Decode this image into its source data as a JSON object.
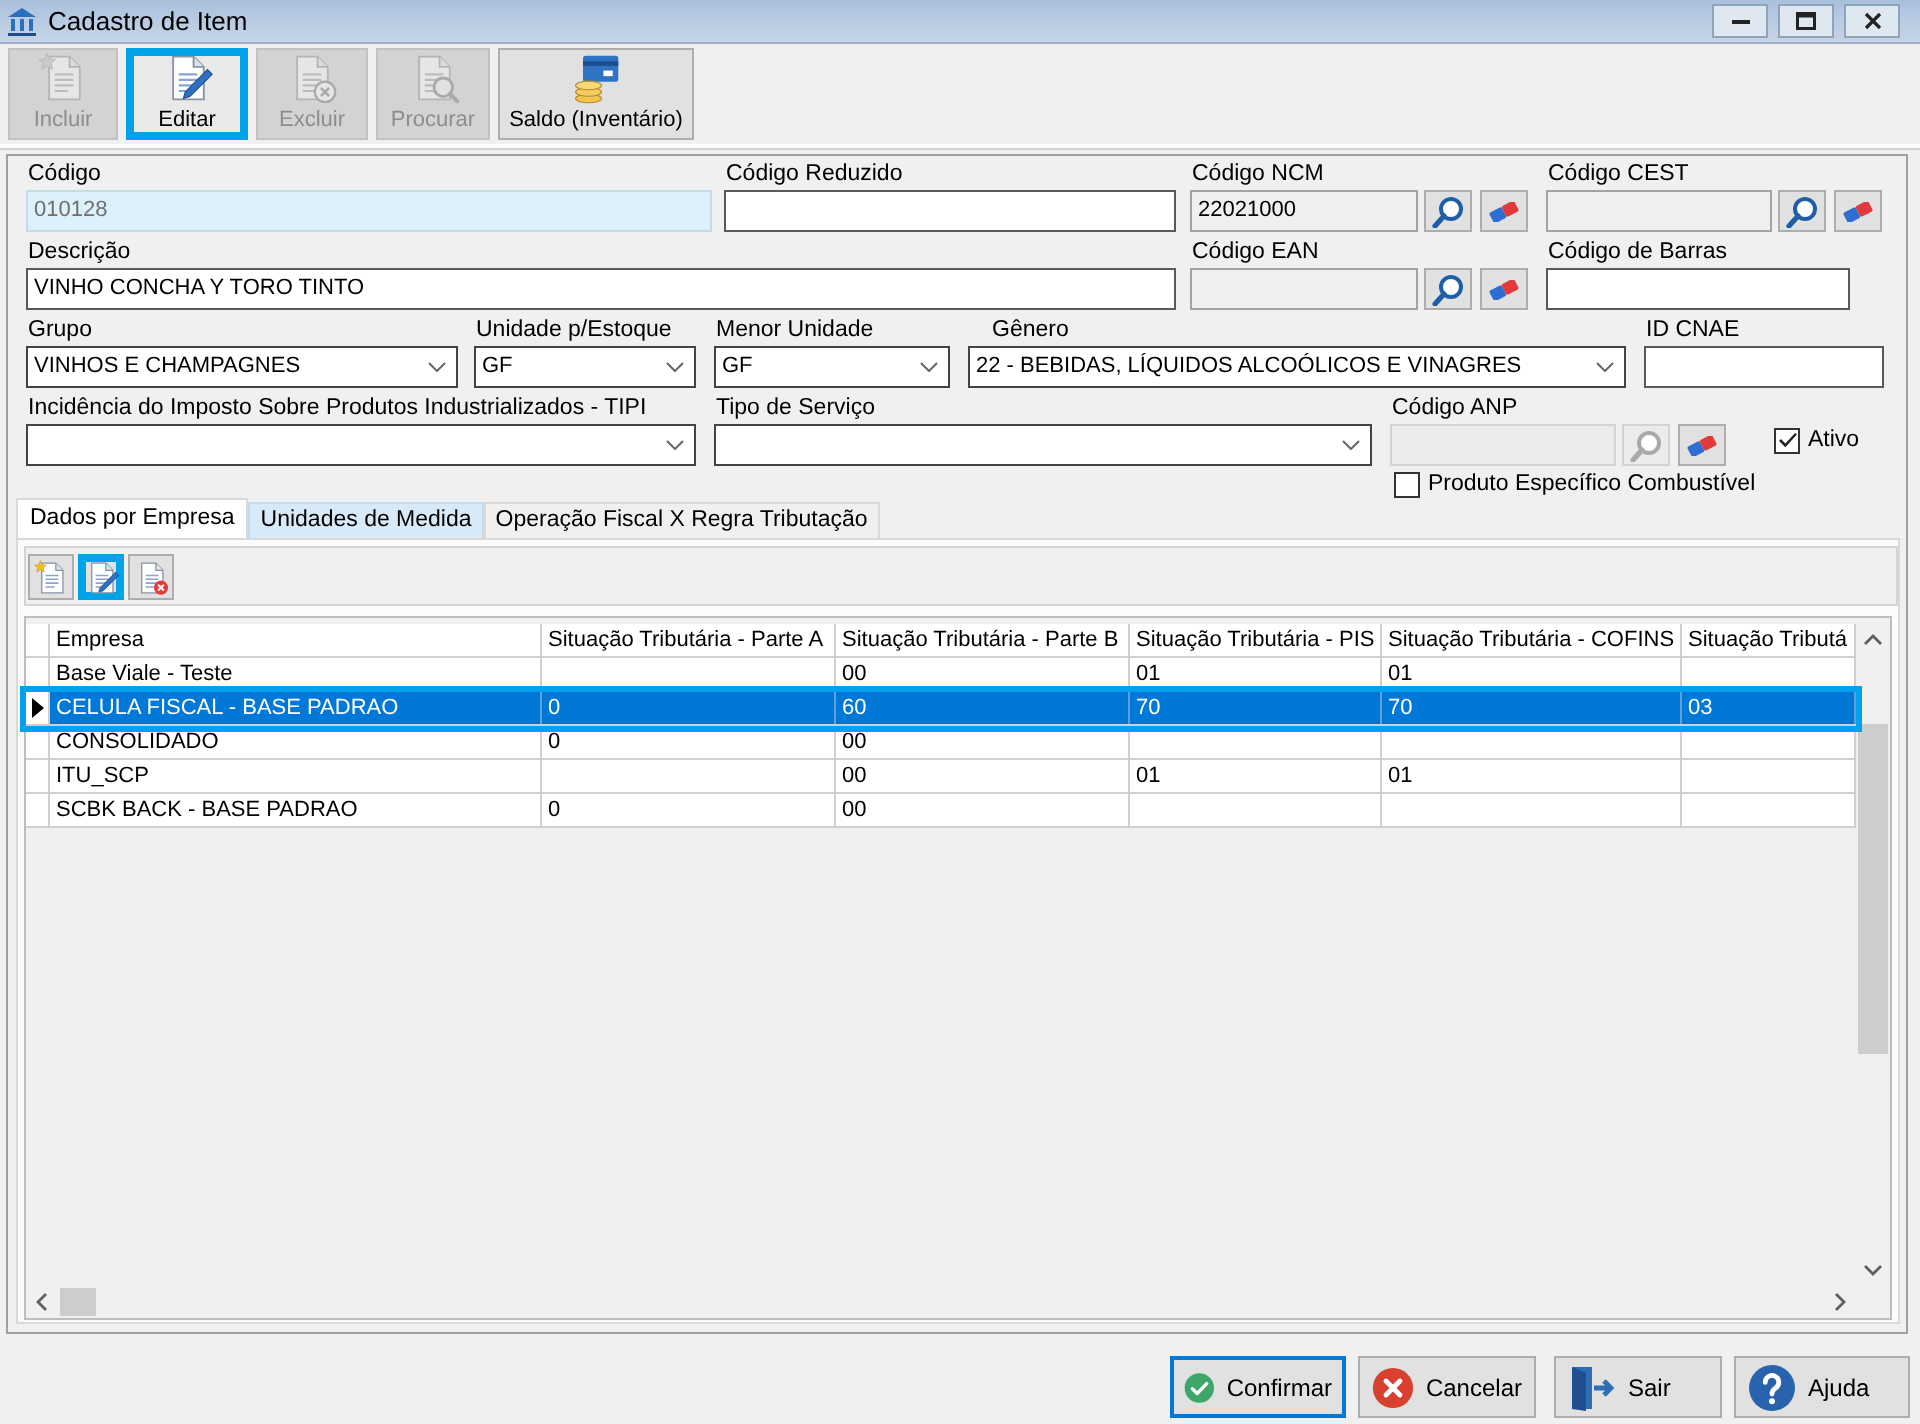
{
  "window": {
    "title": "Cadastro de Item"
  },
  "toolbar": [
    {
      "kind": "new",
      "label": "Incluir",
      "disabled": true,
      "highlighted": false
    },
    {
      "kind": "edit",
      "label": "Editar",
      "disabled": false,
      "highlighted": true
    },
    {
      "kind": "delete",
      "label": "Excluir",
      "disabled": true,
      "highlighted": false
    },
    {
      "kind": "search",
      "label": "Procurar",
      "disabled": true,
      "highlighted": false
    },
    {
      "kind": "stock",
      "label": "Saldo (Inventário)",
      "disabled": false,
      "highlighted": false
    }
  ],
  "form": {
    "fields": [
      {
        "kind": "text",
        "label": "Código",
        "value": "010128",
        "locked": true
      },
      {
        "kind": "text",
        "label": "Código Reduzido",
        "locked": false
      },
      {
        "kind": "lookup",
        "label": "Código NCM",
        "value": "22021000",
        "disabled": false
      },
      {
        "kind": "lookup",
        "label": "Código CEST",
        "disabled": false
      },
      {
        "kind": "text",
        "label": "Descrição",
        "value": "VINHO CONCHA Y TORO TINTO",
        "locked": false
      },
      {
        "kind": "lookup",
        "label": "Código EAN",
        "disabled": false
      },
      {
        "kind": "text",
        "label": "Código de Barras",
        "locked": false
      },
      {
        "kind": "combo",
        "label": "Grupo",
        "value": "VINHOS E CHAMPAGNES"
      },
      {
        "kind": "combo",
        "label": "Unidade p/Estoque",
        "value": "GF"
      },
      {
        "kind": "combo",
        "label": "Menor Unidade",
        "value": "GF"
      },
      {
        "kind": "combo",
        "label": "Gênero",
        "value": "22 - BEBIDAS, LÍQUIDOS ALCOÓLICOS E VINAGRES"
      },
      {
        "kind": "text",
        "label": "ID CNAE",
        "locked": false
      },
      {
        "kind": "combo",
        "label": "Incidência do Imposto Sobre Produtos Industrializados - TIPI"
      },
      {
        "kind": "combo",
        "label": "Tipo de Serviço"
      },
      {
        "kind": "lookup",
        "label": "Código ANP",
        "disabled": true
      },
      {
        "kind": "checkbox",
        "label": "Ativo",
        "checked": true
      },
      {
        "kind": "checkbox",
        "label": "Produto Específico Combustível",
        "checked": false
      }
    ]
  },
  "tabs": [
    {
      "label": "Dados por Empresa",
      "selected": true,
      "hovered": false
    },
    {
      "label": "Unidades de Medida",
      "selected": false,
      "hovered": true
    },
    {
      "label": "Operação Fiscal X Regra Tributação",
      "selected": false,
      "hovered": false
    }
  ],
  "grid_toolbar": [
    {
      "kind": "new",
      "highlighted": false
    },
    {
      "kind": "edit",
      "highlighted": true
    },
    {
      "kind": "delete",
      "highlighted": false
    }
  ],
  "grid": {
    "columns": [
      "Empresa",
      "Situação Tributária - Parte A",
      "Situação Tributária - Parte B",
      "Situação Tributária - PIS",
      "Situação Tributária - COFINS",
      "Situação Tributá"
    ],
    "rows": [
      {
        "cells": [
          "Base Viale - Teste",
          null,
          "00",
          "01",
          "01",
          null
        ],
        "selected": false,
        "highlighted": false
      },
      {
        "cells": [
          "CELULA FISCAL - BASE PADRAO",
          "0",
          "60",
          "70",
          "70",
          "03"
        ],
        "selected": true,
        "highlighted": true
      },
      {
        "cells": [
          "CONSOLIDADO",
          "0",
          "00",
          null,
          null,
          null
        ],
        "selected": false,
        "highlighted": false
      },
      {
        "cells": [
          "ITU_SCP",
          null,
          "00",
          "01",
          "01",
          null
        ],
        "selected": false,
        "highlighted": false
      },
      {
        "cells": [
          "SCBK BACK - BASE PADRAO",
          "0",
          "00",
          null,
          null,
          null
        ],
        "selected": false,
        "highlighted": false
      }
    ]
  },
  "buttons": [
    {
      "kind": "confirm",
      "label": "Confirmar",
      "focused": true
    },
    {
      "kind": "cancel",
      "label": "Cancelar",
      "focused": false
    },
    {
      "kind": "exit",
      "label": "Sair",
      "focused": false
    },
    {
      "kind": "help",
      "label": "Ajuda",
      "focused": false
    }
  ]
}
